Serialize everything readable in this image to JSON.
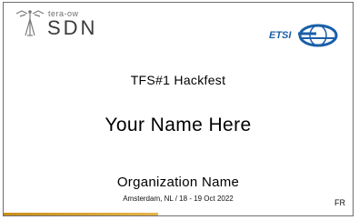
{
  "logos": {
    "teraflow_small": "tera-ow",
    "teraflow_big": "SDN",
    "teraflow_icon": "teraflow-tower-icon",
    "etsi_text": "ETSI",
    "etsi_icon": "etsi-globe-icon",
    "colors": {
      "etsi_blue": "#1b5fa8",
      "accent_gold": "#d9a030"
    }
  },
  "badge": {
    "event_title": "TFS#1 Hackfest",
    "name": "Your Name Here",
    "organization": "Organization Name",
    "location_date": "Amsterdam, NL / 18 - 19 Oct 2022",
    "country_code": "FR"
  }
}
